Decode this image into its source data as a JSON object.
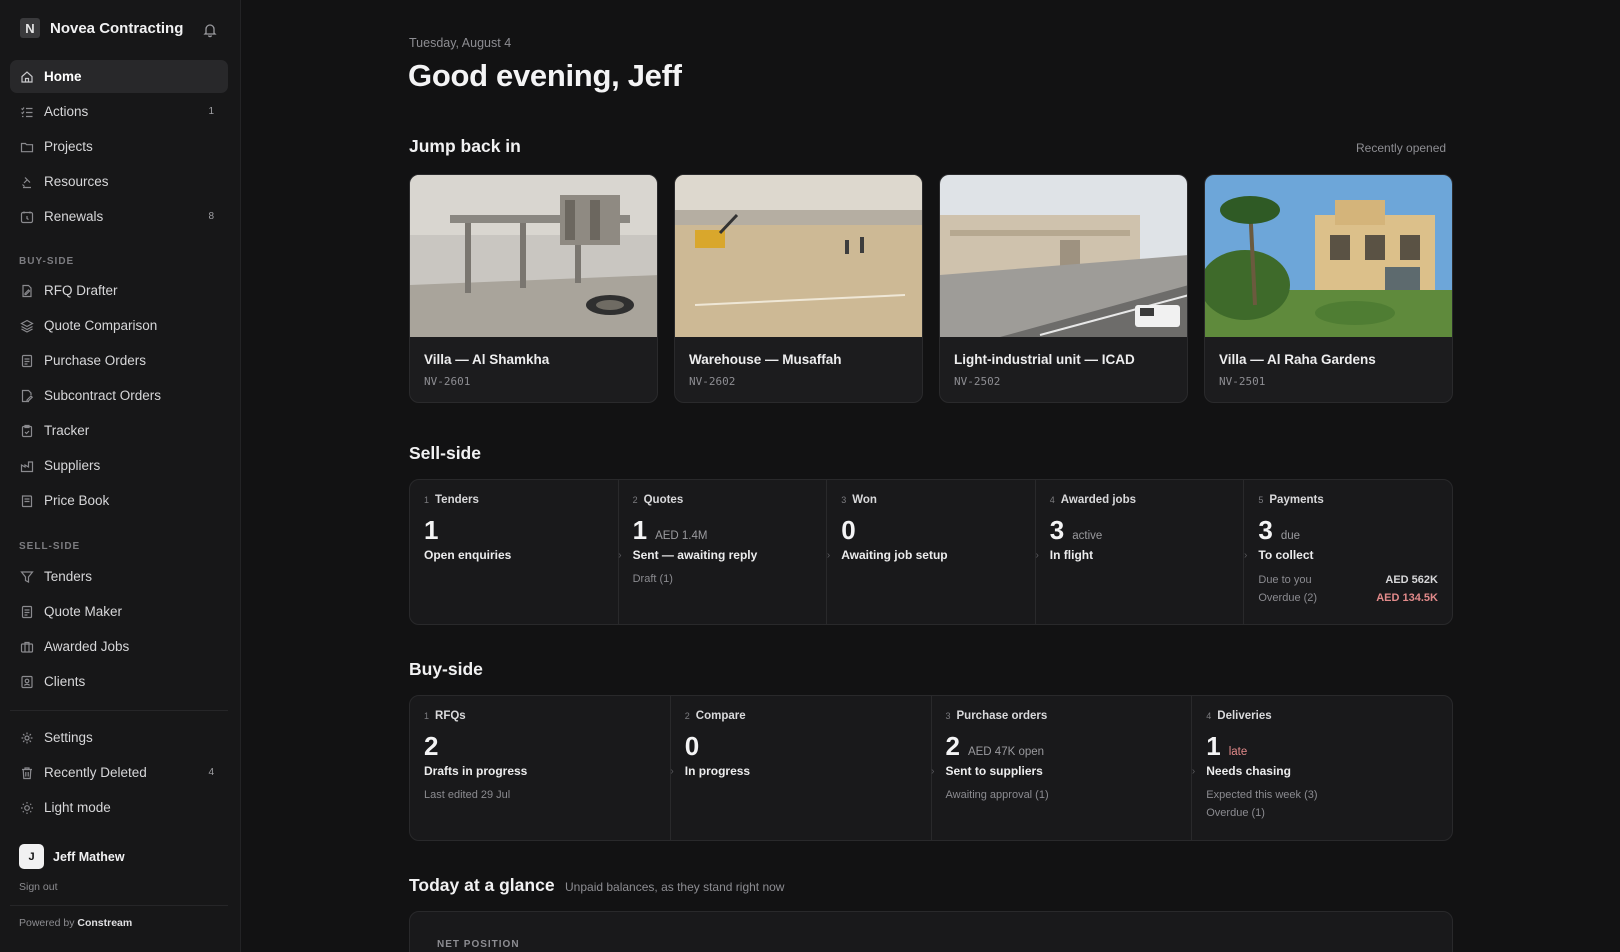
{
  "sidebar": {
    "brand": "Novea Contracting",
    "main_items": [
      {
        "label": "Home",
        "badge": ""
      },
      {
        "label": "Actions",
        "badge": "1"
      },
      {
        "label": "Projects",
        "badge": ""
      },
      {
        "label": "Resources",
        "badge": ""
      },
      {
        "label": "Renewals",
        "badge": "8"
      }
    ],
    "buy_label": "BUY-SIDE",
    "buy_items": [
      {
        "label": "RFQ Drafter"
      },
      {
        "label": "Quote Comparison"
      },
      {
        "label": "Purchase Orders"
      },
      {
        "label": "Subcontract Orders"
      },
      {
        "label": "Tracker"
      },
      {
        "label": "Suppliers"
      },
      {
        "label": "Price Book"
      }
    ],
    "sell_label": "SELL-SIDE",
    "sell_items": [
      {
        "label": "Tenders"
      },
      {
        "label": "Quote Maker"
      },
      {
        "label": "Awarded Jobs"
      },
      {
        "label": "Clients"
      }
    ],
    "bottom_items": [
      {
        "label": "Settings",
        "badge": ""
      },
      {
        "label": "Recently Deleted",
        "badge": "4"
      },
      {
        "label": "Light mode",
        "badge": ""
      }
    ],
    "user": {
      "initial": "J",
      "name": "Jeff Mathew"
    },
    "signout": "Sign out",
    "powered_prefix": "Powered by",
    "powered_brand": "Constream"
  },
  "header": {
    "date": "Tuesday, August 4",
    "greeting": "Good evening, Jeff"
  },
  "jump": {
    "title": "Jump back in",
    "recent_label": "Recently opened",
    "cards": [
      {
        "title": "Villa — Al Shamkha",
        "code": "NV-2601"
      },
      {
        "title": "Warehouse — Musaffah",
        "code": "NV-2602"
      },
      {
        "title": "Light-industrial unit — ICAD",
        "code": "NV-2502"
      },
      {
        "title": "Villa — Al Raha Gardens",
        "code": "NV-2501"
      }
    ]
  },
  "sell": {
    "title": "Sell-side",
    "cells": [
      {
        "num": "1",
        "head": "Tenders",
        "value": "1",
        "aux": "",
        "label": "Open enquiries",
        "sub": ""
      },
      {
        "num": "2",
        "head": "Quotes",
        "value": "1",
        "aux": "AED 1.4M",
        "label": "Sent — awaiting reply",
        "sub": "Draft (1)"
      },
      {
        "num": "3",
        "head": "Won",
        "value": "0",
        "aux": "",
        "label": "Awaiting job setup",
        "sub": ""
      },
      {
        "num": "4",
        "head": "Awarded jobs",
        "value": "3",
        "aux": "active",
        "label": "In flight",
        "sub": ""
      },
      {
        "num": "5",
        "head": "Payments",
        "value": "3",
        "aux": "due",
        "label": "To collect",
        "rows": [
          {
            "k": "Due to you",
            "v": "AED 562K"
          },
          {
            "k": "Overdue (2)",
            "v": "AED 134.5K"
          }
        ]
      }
    ]
  },
  "buy": {
    "title": "Buy-side",
    "cells": [
      {
        "num": "1",
        "head": "RFQs",
        "value": "2",
        "aux": "",
        "label": "Drafts in progress",
        "sub": "Last edited 29 Jul",
        "sub2": ""
      },
      {
        "num": "2",
        "head": "Compare",
        "value": "0",
        "aux": "",
        "label": "In progress",
        "sub": "",
        "sub2": ""
      },
      {
        "num": "3",
        "head": "Purchase orders",
        "value": "2",
        "aux": "AED 47K open",
        "label": "Sent to suppliers",
        "sub": "Awaiting approval (1)",
        "sub2": ""
      },
      {
        "num": "4",
        "head": "Deliveries",
        "value": "1",
        "aux": "late",
        "label": "Needs chasing",
        "sub": "Expected this week (3)",
        "sub2": "Overdue (1)"
      }
    ]
  },
  "glance": {
    "title": "Today at a glance",
    "subtitle": "Unpaid balances, as they stand right now",
    "net_label": "NET POSITION"
  },
  "colors": {
    "accent_red": "#e28a8a",
    "background": "#121213",
    "sidebar": "#171718"
  }
}
